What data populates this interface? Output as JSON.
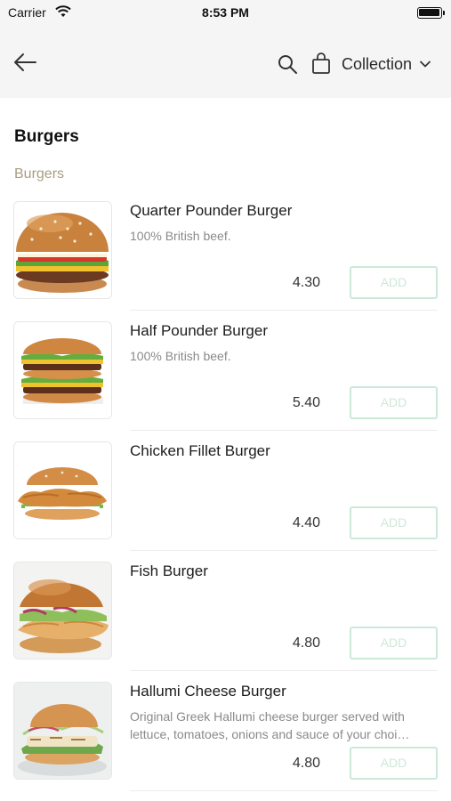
{
  "status_bar": {
    "carrier": "Carrier",
    "time": "8:53 PM",
    "battery_level": 1.0
  },
  "nav": {
    "back_icon": "back-arrow-icon",
    "search_icon": "search-icon",
    "bag_icon": "shopping-bag-icon",
    "collection_label": "Collection",
    "chevron_icon": "chevron-down-icon"
  },
  "section": {
    "title": "Burgers",
    "subtitle": "Burgers"
  },
  "items": [
    {
      "name": "Quarter Pounder Burger",
      "description": "100% British beef.",
      "price": "4.30",
      "add_label": "ADD"
    },
    {
      "name": "Half Pounder Burger",
      "description": "100% British beef.",
      "price": "5.40",
      "add_label": "ADD"
    },
    {
      "name": "Chicken Fillet Burger",
      "description": "",
      "price": "4.40",
      "add_label": "ADD"
    },
    {
      "name": "Fish Burger",
      "description": "",
      "price": "4.80",
      "add_label": "ADD"
    },
    {
      "name": "Hallumi Cheese Burger",
      "description": "Original Greek Hallumi cheese burger served with lettuce, tomatoes, onions and sauce of your choi…",
      "price": "4.80",
      "add_label": "ADD"
    }
  ],
  "colors": {
    "header_bg": "#f5f5f5",
    "subtitle": "#a99d82",
    "add_border": "#cce8d8",
    "add_text": "#cfe8d9"
  }
}
